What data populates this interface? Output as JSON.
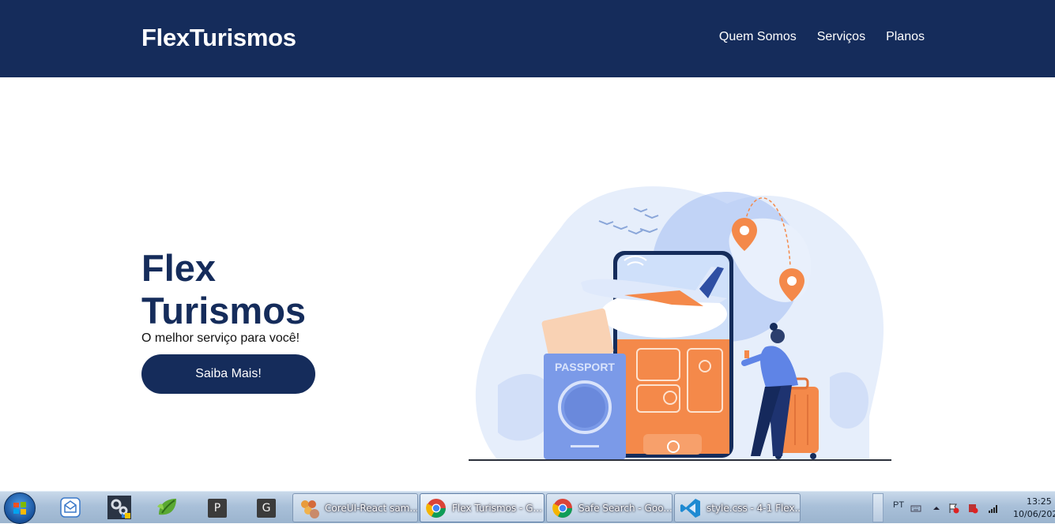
{
  "header": {
    "brand": "FlexTurismos",
    "nav": [
      "Quem Somos",
      "Serviços",
      "Planos"
    ]
  },
  "hero": {
    "title": "Flex Turismos",
    "subtitle": "O melhor serviço para você!",
    "cta_label": "Saiba Mais!"
  },
  "illustration": {
    "passport_label": "PASSPORT"
  },
  "taskbar": {
    "pinned": [
      "mail-icon",
      "settings-icon",
      "leaf-icon",
      "P",
      "G"
    ],
    "tasks": [
      {
        "label": "CoreUI-React sam...",
        "icon": "hexagon-app-icon"
      },
      {
        "label": "Flex Turismos - G...",
        "icon": "chrome-icon"
      },
      {
        "label": "Safe Search - Goo...",
        "icon": "chrome-icon"
      },
      {
        "label": "style.css - 4-1 Flex...",
        "icon": "vscode-icon"
      }
    ],
    "language": "PT",
    "time": "13:25",
    "date": "10/06/202"
  },
  "colors": {
    "primary": "#152c5b",
    "accent": "#f4894a",
    "illustration_blue": "#5f84e6"
  }
}
